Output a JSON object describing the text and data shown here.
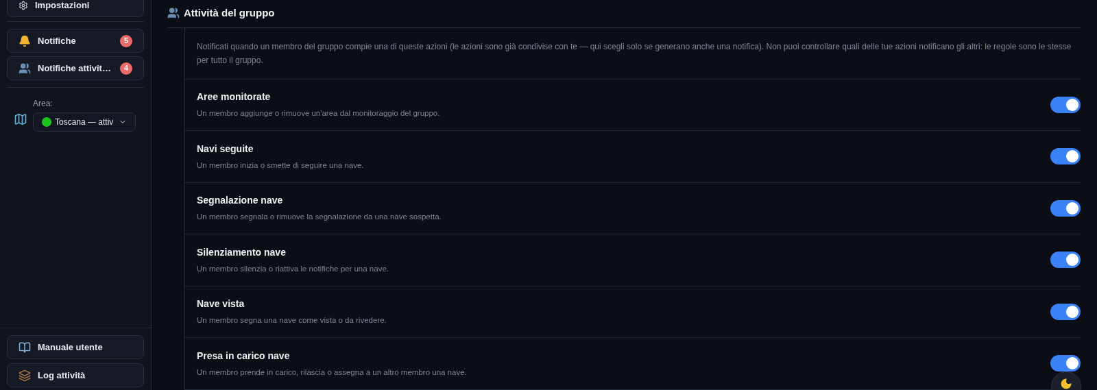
{
  "sidebar": {
    "top_button": {
      "label": "Impostazioni"
    },
    "nav": [
      {
        "kind": "bell",
        "label": "Notifiche",
        "badge": "5"
      },
      {
        "kind": "users",
        "label": "Notifiche attivit…",
        "badge": "4"
      }
    ],
    "area": {
      "label": "Area:",
      "value": "Toscana — attiv"
    },
    "bottom": [
      {
        "kind": "book",
        "label": "Manuale utente"
      },
      {
        "kind": "log",
        "label": "Log attività"
      }
    ]
  },
  "section": {
    "title": "Attività del gruppo",
    "description": "Notificati quando un membro del gruppo compie una di queste azioni (le azioni sono già condivise con te — qui scegli solo se generano anche una notifica). Non puoi controllare quali delle tue azioni notificano gli altri: le regole sono le stesse per tutto il gruppo.",
    "settings": [
      {
        "title": "Aree monitorate",
        "description": "Un membro aggiunge o rimuove un'area dal monitoraggio del gruppo.",
        "on": true
      },
      {
        "title": "Navi seguite",
        "description": "Un membro inizia o smette di seguire una nave.",
        "on": true
      },
      {
        "title": "Segnalazione nave",
        "description": "Un membro segnala o rimuove la segnalazione da una nave sospetta.",
        "on": true
      },
      {
        "title": "Silenziamento nave",
        "description": "Un membro silenzia o riattiva le notifiche per una nave.",
        "on": true
      },
      {
        "title": "Nave vista",
        "description": "Un membro segna una nave come vista o da rivedere.",
        "on": true
      },
      {
        "title": "Presa in carico nave",
        "description": "Un membro prende in carico, rilascia o assegna a un altro membro una nave.",
        "on": true
      }
    ]
  }
}
